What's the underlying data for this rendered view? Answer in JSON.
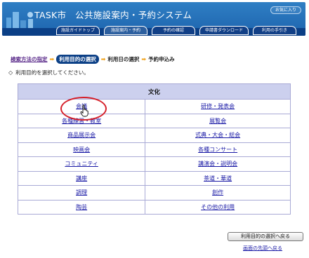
{
  "header": {
    "title": "TASK市　公共施設案内・予約システム",
    "favorites_label": "お気に入り",
    "nav": [
      {
        "label": "施設ガイドトップ"
      },
      {
        "label": "施設案内・予約"
      },
      {
        "label": "予約の確認"
      },
      {
        "label": "申請書ダウンロード"
      },
      {
        "label": "利用の手引き"
      }
    ],
    "active_nav_index": 1
  },
  "steps": {
    "search_method": "検索方法の指定",
    "purpose": "利用目的の選択",
    "date": "利用日の選択",
    "apply": "予約申込み"
  },
  "instruction": "利用目的を選択してください。",
  "table": {
    "category": "文化",
    "rows": [
      [
        "会議",
        "研修・発表会"
      ],
      [
        "各種練習・教室",
        "展覧会"
      ],
      [
        "商品展示会",
        "式典・大会・総会"
      ],
      [
        "映画会",
        "各種コンサート"
      ],
      [
        "コミュニティ",
        "講演会・説明会"
      ],
      [
        "講座",
        "茶道・華道"
      ],
      [
        "調理",
        "創作"
      ],
      [
        "陶芸",
        "その他の利用"
      ]
    ]
  },
  "back_button": "利用目的の選択へ戻る",
  "to_top": "画面の先頭へ戻る",
  "colors": {
    "header_blue": "#1d63ad",
    "nav_dark": "#0b3f86",
    "table_header": "#ccd0ee",
    "step_arrow": "#f0a21a",
    "highlight_circle": "#d6202a"
  }
}
